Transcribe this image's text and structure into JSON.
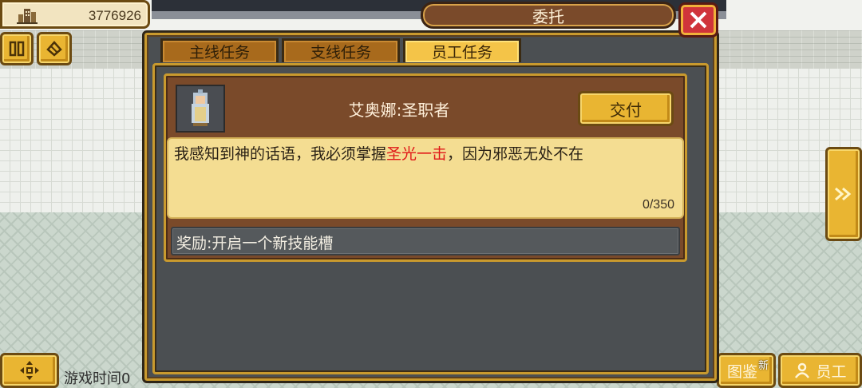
{
  "hud": {
    "money": "3776926",
    "game_time_label": "游戏时间0"
  },
  "dialog": {
    "title": "委托",
    "tabs": [
      {
        "label": "主线任务",
        "active": false
      },
      {
        "label": "支线任务",
        "active": false
      },
      {
        "label": "员工任务",
        "active": true
      }
    ],
    "task": {
      "name": "艾奥娜:圣职者",
      "deliver_label": "交付",
      "desc_before": "我感知到神的话语，我必须掌握",
      "desc_highlight": "圣光一击",
      "desc_after": "，因为邪恶无处不在",
      "progress": "0/350",
      "reward": "奖励:开启一个新技能槽"
    }
  },
  "bottom_buttons": {
    "catalog_label": "图鉴",
    "new_badge": "新",
    "staff_label": "员工"
  },
  "colors": {
    "gold": "#e9b532",
    "highlight_text": "#e01818",
    "close_red": "#d0343a"
  }
}
